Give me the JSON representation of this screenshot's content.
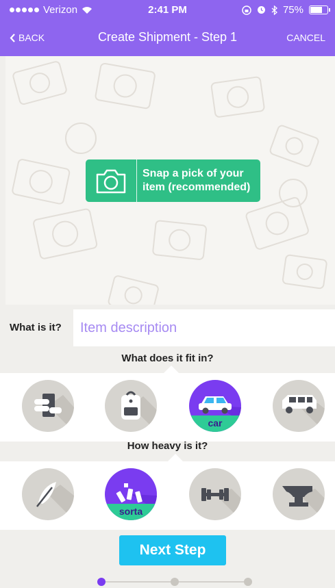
{
  "status_bar": {
    "carrier": "Verizon",
    "time": "2:41 PM",
    "battery_text": "75%",
    "battery_level": 0.75
  },
  "nav": {
    "back_label": "BACK",
    "title": "Create Shipment - Step 1",
    "cancel_label": "CANCEL"
  },
  "photo": {
    "snap_label": "Snap a pick of your item (recommended)",
    "icon": "camera-icon"
  },
  "description": {
    "label": "What is it?",
    "placeholder": "Item description",
    "value": ""
  },
  "fit": {
    "label": "What does it fit in?",
    "options": [
      {
        "icon": "hand-book-icon",
        "label": "",
        "selected": false
      },
      {
        "icon": "backpack-icon",
        "label": "",
        "selected": false
      },
      {
        "icon": "car-icon",
        "label": "car",
        "selected": true
      },
      {
        "icon": "suv-icon",
        "label": "",
        "selected": false
      }
    ]
  },
  "weight": {
    "label": "How heavy is it?",
    "options": [
      {
        "icon": "feather-icon",
        "label": "",
        "selected": false
      },
      {
        "icon": "bricks-icon",
        "label": "sorta",
        "selected": true
      },
      {
        "icon": "dumbbell-icon",
        "label": "",
        "selected": false
      },
      {
        "icon": "anvil-icon",
        "label": "",
        "selected": false
      }
    ]
  },
  "next_button": {
    "label": "Next Step"
  },
  "progress": {
    "steps": 3,
    "current_step": 1
  },
  "colors": {
    "accent_purple": "#8e65ef",
    "selected_purple": "#7a3cf0",
    "green": "#2fbf86",
    "next_blue": "#1ec2f0"
  }
}
